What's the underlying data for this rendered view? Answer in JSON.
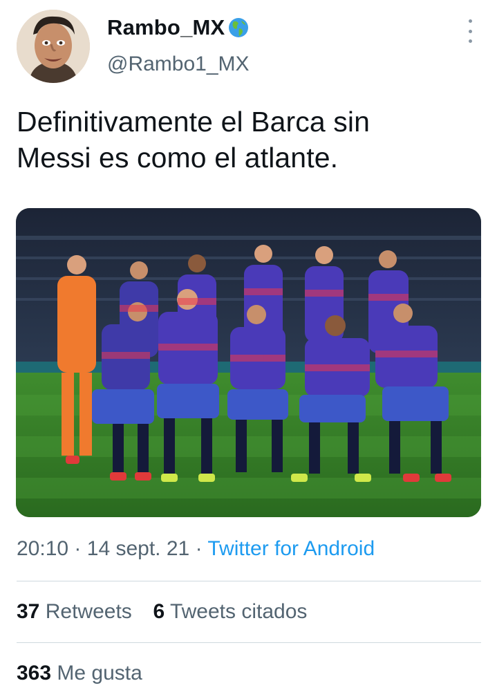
{
  "author": {
    "display_name": "Rambo_MX",
    "display_name_emoji_icon": "globe-americas-icon",
    "handle": "@Rambo1_MX"
  },
  "tweet": {
    "text_lines": [
      "Definitivamente el Barca sin",
      "Messi es como el atlante."
    ]
  },
  "media": {
    "type": "photo",
    "description_icon": "team-photo"
  },
  "meta": {
    "time": "20:10",
    "separator": "·",
    "date": "14 sept. 21",
    "source": "Twitter for Android"
  },
  "stats": {
    "retweets_count": "37",
    "retweets_label": "Retweets",
    "quotes_count": "6",
    "quotes_label": "Tweets citados",
    "likes_count": "363",
    "likes_label": "Me gusta"
  },
  "colors": {
    "text_primary": "#0f1419",
    "text_secondary": "#536471",
    "link": "#1d9bf0",
    "divider": "#cfd9de"
  }
}
